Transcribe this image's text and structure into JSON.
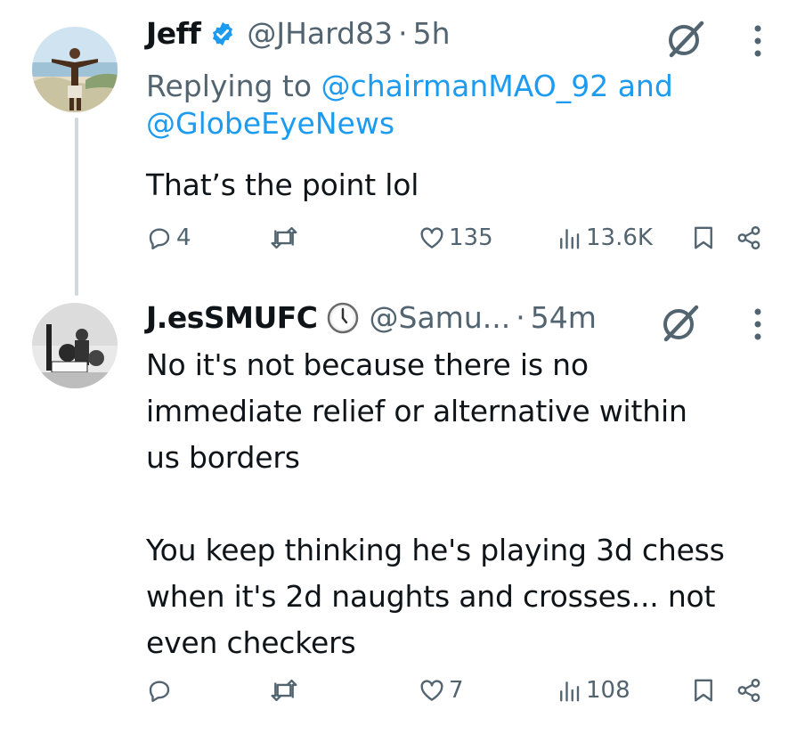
{
  "tweets": [
    {
      "name": "Jeff",
      "handle": "@JHard83",
      "separator": "·",
      "time": "5h",
      "replying_prefix": "Replying to",
      "mention_1": "@chairmanMAO_92",
      "mention_joiner": "and",
      "mention_2": "@GlobeEyeNews",
      "text": "That’s the point lol",
      "replies": "4",
      "reposts": "",
      "likes": "135",
      "views": "13.6K",
      "verified_color": "#1d9bf0"
    },
    {
      "name": "J.esSMUFC",
      "badge_icon": "clock-icon",
      "handle": "@Samu...",
      "separator": "·",
      "time": "54m",
      "text": "No it's not because there is no\nimmediate relief or alternative within\nus borders\n\nYou keep thinking he's playing 3d chess\nwhen it's 2d naughts and crosses... not\neven checkers",
      "replies": "",
      "reposts": "",
      "likes": "7",
      "views": "108"
    }
  ],
  "colors": {
    "text": "#0f1419",
    "secondary": "#536471",
    "link": "#1d9bf0",
    "thread_line": "#cfd9de"
  }
}
